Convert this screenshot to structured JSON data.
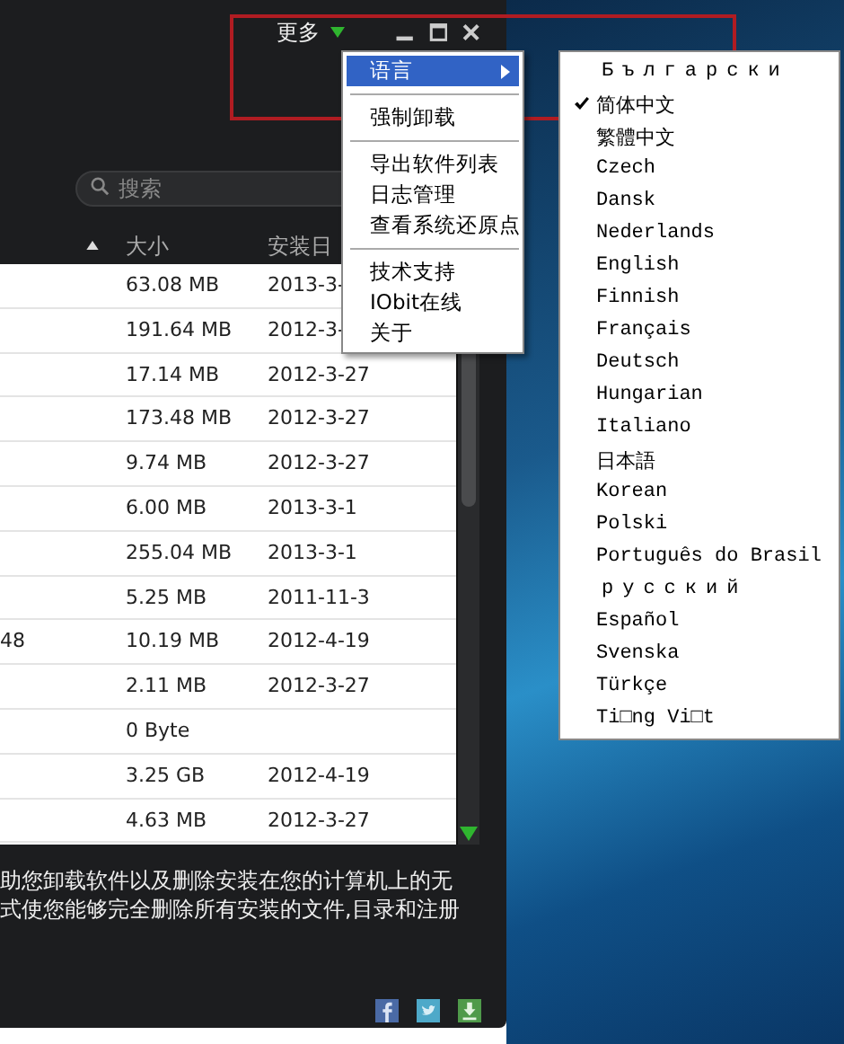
{
  "title_bar": {
    "more_label": "更多"
  },
  "search": {
    "placeholder": "搜索"
  },
  "table": {
    "columns": [
      "大小",
      "安装日"
    ],
    "rows": [
      {
        "column_1": "",
        "size": "63.08 MB",
        "date": "2013-3-"
      },
      {
        "column_1": "",
        "size": "191.64 MB",
        "date": "2012-3-"
      },
      {
        "column_1": "",
        "size": "17.14 MB",
        "date": "2012-3-27"
      },
      {
        "column_1": "",
        "size": "173.48 MB",
        "date": "2012-3-27"
      },
      {
        "column_1": "",
        "size": "9.74 MB",
        "date": "2012-3-27"
      },
      {
        "column_1": "",
        "size": "6.00 MB",
        "date": "2013-3-1"
      },
      {
        "column_1": "",
        "size": "255.04 MB",
        "date": "2013-3-1"
      },
      {
        "column_1": "",
        "size": "5.25 MB",
        "date": "2011-11-3"
      },
      {
        "column_1": "48",
        "size": "10.19 MB",
        "date": "2012-4-19"
      },
      {
        "column_1": "",
        "size": "2.11 MB",
        "date": "2012-3-27"
      },
      {
        "column_1": "",
        "size": "0 Byte",
        "date": ""
      },
      {
        "column_1": "",
        "size": "3.25 GB",
        "date": "2012-4-19"
      },
      {
        "column_1": "",
        "size": "4.63 MB",
        "date": "2012-3-27"
      }
    ]
  },
  "description": [
    "助您卸载软件以及删除安装在您的计算机上的无",
    "式使您能够完全删除所有安装的文件,目录和注册"
  ],
  "menu": {
    "items": [
      {
        "kind": "submenu",
        "label": "语言",
        "selected": true
      },
      {
        "kind": "separator"
      },
      {
        "kind": "item",
        "label": "强制卸载",
        "selected": false
      },
      {
        "kind": "separator"
      },
      {
        "kind": "item",
        "label": "导出软件列表",
        "selected": false
      },
      {
        "kind": "item",
        "label": "日志管理",
        "selected": false
      },
      {
        "kind": "item",
        "label": "查看系统还原点",
        "selected": false
      },
      {
        "kind": "separator"
      },
      {
        "kind": "item",
        "label": "技术支持",
        "selected": false
      },
      {
        "kind": "item",
        "label": "IObit在线",
        "selected": false
      },
      {
        "kind": "item",
        "label": "关于",
        "selected": false
      }
    ]
  },
  "language_menu": {
    "items": [
      {
        "label": "Български",
        "spaced": true,
        "checked": false
      },
      {
        "label": "简体中文",
        "spaced": false,
        "checked": true
      },
      {
        "label": "繁體中文",
        "spaced": false,
        "checked": false
      },
      {
        "label": "Czech",
        "spaced": false,
        "checked": false
      },
      {
        "label": "Dansk",
        "spaced": false,
        "checked": false
      },
      {
        "label": "Nederlands",
        "spaced": false,
        "checked": false
      },
      {
        "label": "English",
        "spaced": false,
        "checked": false
      },
      {
        "label": "Finnish",
        "spaced": false,
        "checked": false
      },
      {
        "label": "Français",
        "spaced": false,
        "checked": false
      },
      {
        "label": "Deutsch",
        "spaced": false,
        "checked": false
      },
      {
        "label": "Hungarian",
        "spaced": false,
        "checked": false
      },
      {
        "label": "Italiano",
        "spaced": false,
        "checked": false
      },
      {
        "label": "日本語",
        "spaced": false,
        "checked": false
      },
      {
        "label": "Korean",
        "spaced": false,
        "checked": false
      },
      {
        "label": "Polski",
        "spaced": false,
        "checked": false
      },
      {
        "label": "Português do Brasil",
        "spaced": false,
        "checked": false
      },
      {
        "label": "русский",
        "spaced": true,
        "checked": false
      },
      {
        "label": "Español",
        "spaced": false,
        "checked": false
      },
      {
        "label": "Svenska",
        "spaced": false,
        "checked": false
      },
      {
        "label": "Türkçe",
        "spaced": false,
        "checked": false
      },
      {
        "label": "Ti□ng Vi□t",
        "spaced": false,
        "checked": false
      }
    ]
  }
}
